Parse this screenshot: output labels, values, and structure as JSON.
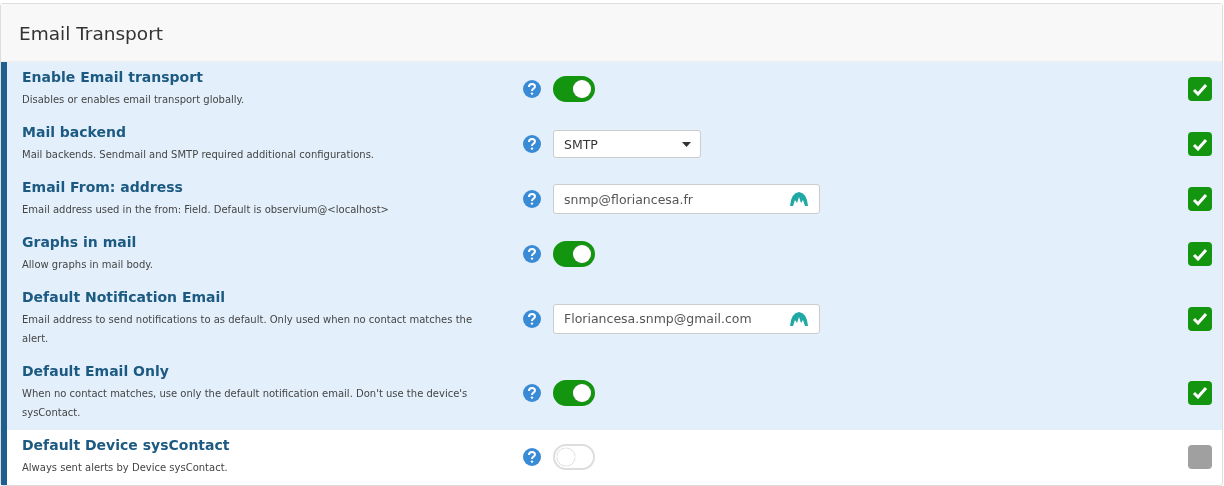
{
  "panel": {
    "title": "Email Transport"
  },
  "settings": [
    {
      "kind": "toggle",
      "label": "Enable Email transport",
      "description": "Disables or enables email transport globally.",
      "on": true,
      "checked": true
    },
    {
      "kind": "select",
      "label": "Mail backend",
      "description": "Mail backends. Sendmail and SMTP required additional configurations.",
      "value": "SMTP",
      "checked": true
    },
    {
      "kind": "text",
      "label": "Email From: address",
      "description": "Email address used in the from: Field. Default is observium@<localhost>",
      "value": "snmp@floriancesa.fr",
      "checked": true
    },
    {
      "kind": "toggle",
      "label": "Graphs in mail",
      "description": "Allow graphs in mail body.",
      "on": true,
      "checked": true
    },
    {
      "kind": "text",
      "label": "Default Notification Email",
      "description": "Email address to send notifications to as default. Only used when no contact matches the alert.",
      "value": "Floriancesa.snmp@gmail.com",
      "checked": true
    },
    {
      "kind": "toggle",
      "label": "Default Email Only",
      "description": "When no contact matches, use only the default notification email. Don't use the device's sysContact.",
      "on": true,
      "checked": true
    },
    {
      "kind": "toggle",
      "label": "Default Device sysContact",
      "description": "Always sent alerts by Device sysContact.",
      "on": false,
      "checked": false
    }
  ]
}
